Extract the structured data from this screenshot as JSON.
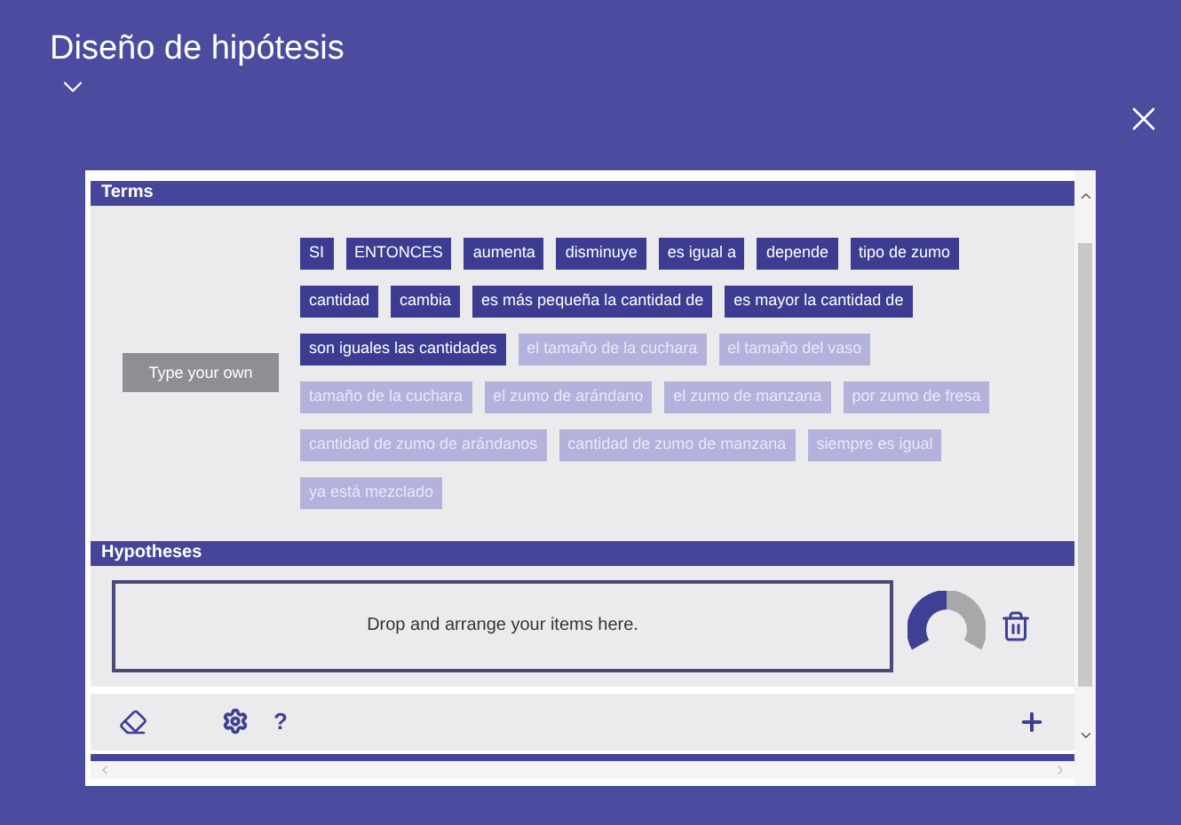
{
  "window": {
    "title": "Diseño de hipótesis"
  },
  "terms": {
    "title": "Terms",
    "custom_button": "Type your own",
    "items": [
      {
        "label": "SI",
        "used": false
      },
      {
        "label": "ENTONCES",
        "used": false
      },
      {
        "label": "aumenta",
        "used": false
      },
      {
        "label": "disminuye",
        "used": false
      },
      {
        "label": "es igual a",
        "used": false
      },
      {
        "label": "depende",
        "used": false
      },
      {
        "label": "tipo de zumo",
        "used": false
      },
      {
        "label": "cantidad",
        "used": false
      },
      {
        "label": "cambia",
        "used": false
      },
      {
        "label": "es más pequeña la cantidad de",
        "used": false
      },
      {
        "label": "es mayor la cantidad de",
        "used": false
      },
      {
        "label": "son iguales las cantidades",
        "used": false
      },
      {
        "label": "el tamaño de la cuchara",
        "used": true
      },
      {
        "label": "el tamaño del vaso",
        "used": true
      },
      {
        "label": "tamaño de la cuchara",
        "used": true
      },
      {
        "label": "el zumo de arándano",
        "used": true
      },
      {
        "label": "el zumo de manzana",
        "used": true
      },
      {
        "label": "por zumo de fresa",
        "used": true
      },
      {
        "label": "cantidad de zumo de arándanos",
        "used": true
      },
      {
        "label": "cantidad de zumo de manzana",
        "used": true
      },
      {
        "label": "siempre es igual",
        "used": true
      },
      {
        "label": "ya está mezclado",
        "used": true
      }
    ]
  },
  "hypotheses": {
    "title": "Hypotheses",
    "dropzone_text": "Drop and arrange your items here."
  },
  "toolbar": {
    "help_label": "?"
  }
}
